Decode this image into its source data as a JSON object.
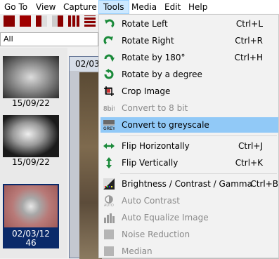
{
  "menubar": [
    "Go To",
    "View",
    "Capture",
    "Tools",
    "Media",
    "Edit",
    "Help"
  ],
  "active_menu": "Tools",
  "filter": {
    "value": "All"
  },
  "thumbnails": [
    {
      "caption": "15/09/22"
    },
    {
      "caption": "15/09/22"
    },
    {
      "caption_line1": "02/03/12",
      "caption_line2": "46"
    }
  ],
  "viewer": {
    "title": "02/03/"
  },
  "tools_menu": {
    "items": [
      {
        "label": "Rotate Left",
        "shortcut": "Ctrl+L",
        "icon": "rotate-left-icon"
      },
      {
        "label": "Rotate Right",
        "shortcut": "Ctrl+R",
        "icon": "rotate-right-icon"
      },
      {
        "label": "Rotate by 180°",
        "shortcut": "Ctrl+H",
        "icon": "rotate-180-icon"
      },
      {
        "label": "Rotate by a degree",
        "shortcut": "",
        "icon": "rotate-degree-icon"
      },
      {
        "label": "Crop Image",
        "shortcut": "",
        "icon": "crop-icon"
      },
      {
        "label": "Convert to 8 bit",
        "shortcut": "",
        "icon": "8bit-icon"
      },
      {
        "label": "Convert to greyscale",
        "shortcut": "",
        "icon": "greyscale-icon"
      },
      {
        "label": "Flip Horizontally",
        "shortcut": "Ctrl+J",
        "icon": "flip-horizontal-icon"
      },
      {
        "label": "Flip Vertically",
        "shortcut": "Ctrl+K",
        "icon": "flip-vertical-icon"
      },
      {
        "label": "Brightness / Contrast / Gamma",
        "shortcut": "Ctrl+B",
        "icon": "brightness-contrast-icon"
      },
      {
        "label": "Auto Contrast",
        "shortcut": "",
        "icon": "auto-contrast-icon"
      },
      {
        "label": "Auto Equalize Image",
        "shortcut": "",
        "icon": "auto-equalize-icon"
      },
      {
        "label": "Noise Reduction",
        "shortcut": "",
        "icon": "noise-reduction-icon"
      },
      {
        "label": "Median",
        "shortcut": "",
        "icon": "median-icon"
      }
    ],
    "disabled": [
      "Convert to 8 bit",
      "Auto Contrast",
      "Auto Equalize Image",
      "Noise Reduction",
      "Median"
    ],
    "highlighted": "Convert to greyscale"
  },
  "colors": {
    "highlight": "#91c9f7",
    "menu_active": "#cce8ff",
    "selection": "#0a2a6a",
    "icon_green": "#1a8a3a"
  }
}
